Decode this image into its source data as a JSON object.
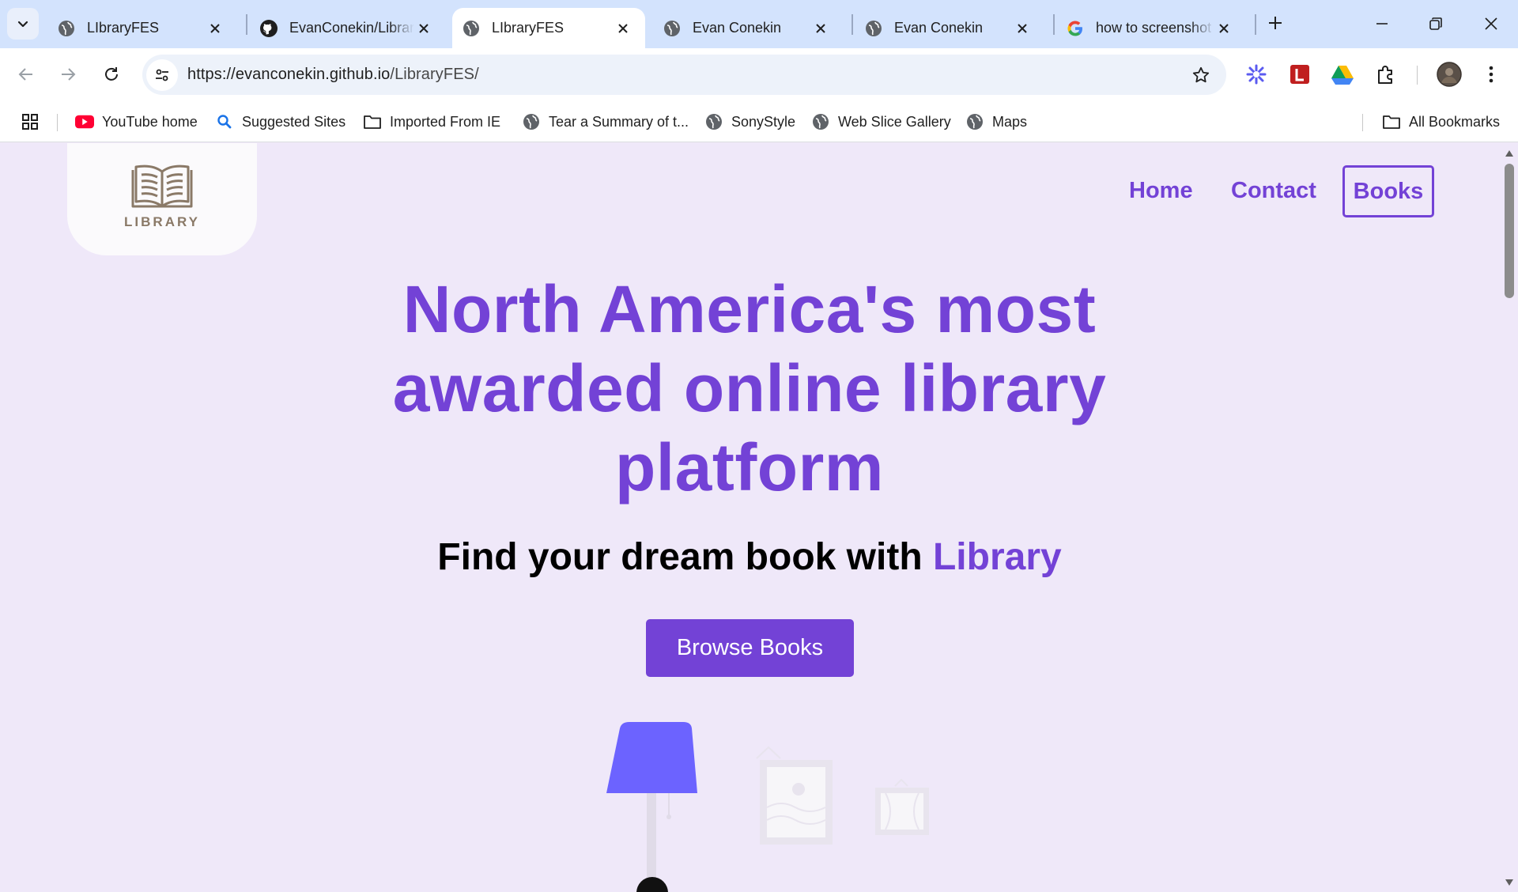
{
  "browser": {
    "tabs": [
      {
        "title": "LIbraryFES",
        "favicon": "globe-icon",
        "active": false
      },
      {
        "title": "EvanConekin/LibraryFES",
        "favicon": "github-icon",
        "active": false
      },
      {
        "title": "LIbraryFES",
        "favicon": "globe-icon",
        "active": true
      },
      {
        "title": "Evan Conekin",
        "favicon": "globe-icon",
        "active": false
      },
      {
        "title": "Evan Conekin",
        "favicon": "globe-icon",
        "active": false
      },
      {
        "title": "how to screenshot",
        "favicon": "google-icon",
        "active": false
      }
    ],
    "url_host": "https://evanconekin.github.io",
    "url_path": "/LibraryFES/",
    "bookmarks": [
      {
        "label": "YouTube home",
        "icon": "youtube-icon"
      },
      {
        "label": "Suggested Sites",
        "icon": "search-icon"
      },
      {
        "label": "Imported From IE",
        "icon": "folder-icon"
      },
      {
        "label": "Tear a Summary of t...",
        "icon": "globe-icon"
      },
      {
        "label": "SonyStyle",
        "icon": "globe-icon"
      },
      {
        "label": "Web Slice Gallery",
        "icon": "globe-icon"
      },
      {
        "label": "Maps",
        "icon": "globe-icon"
      }
    ],
    "all_bookmarks_label": "All Bookmarks"
  },
  "site": {
    "logo_text": "LIBRARY",
    "nav": {
      "home": "Home",
      "contact": "Contact",
      "books": "Books"
    },
    "hero": {
      "title": "North America's most awarded online library platform",
      "subtitle_prefix": "Find your dream book with",
      "subtitle_accent": "Library",
      "cta_label": "Browse Books"
    }
  },
  "colors": {
    "accent": "#7342d6",
    "page_background": "#efe8f9",
    "lamp": "#6c63ff",
    "tab_strip": "#d3e3fd"
  }
}
